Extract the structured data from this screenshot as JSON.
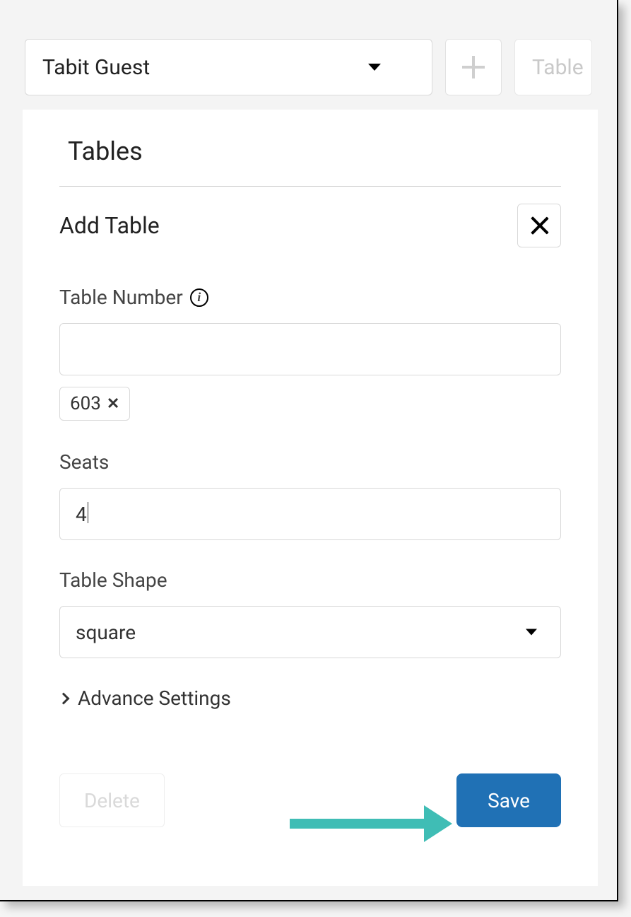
{
  "topbar": {
    "dropdown_label": "Tabit Guest",
    "secondary_label": "Table"
  },
  "panel": {
    "title": "Tables",
    "subtitle": "Add Table",
    "fields": {
      "table_number_label": "Table Number",
      "table_number_value": "",
      "chip_value": "603",
      "seats_label": "Seats",
      "seats_value": "4",
      "shape_label": "Table Shape",
      "shape_value": "square"
    },
    "advance_label": "Advance Settings",
    "delete_label": "Delete",
    "save_label": "Save"
  }
}
